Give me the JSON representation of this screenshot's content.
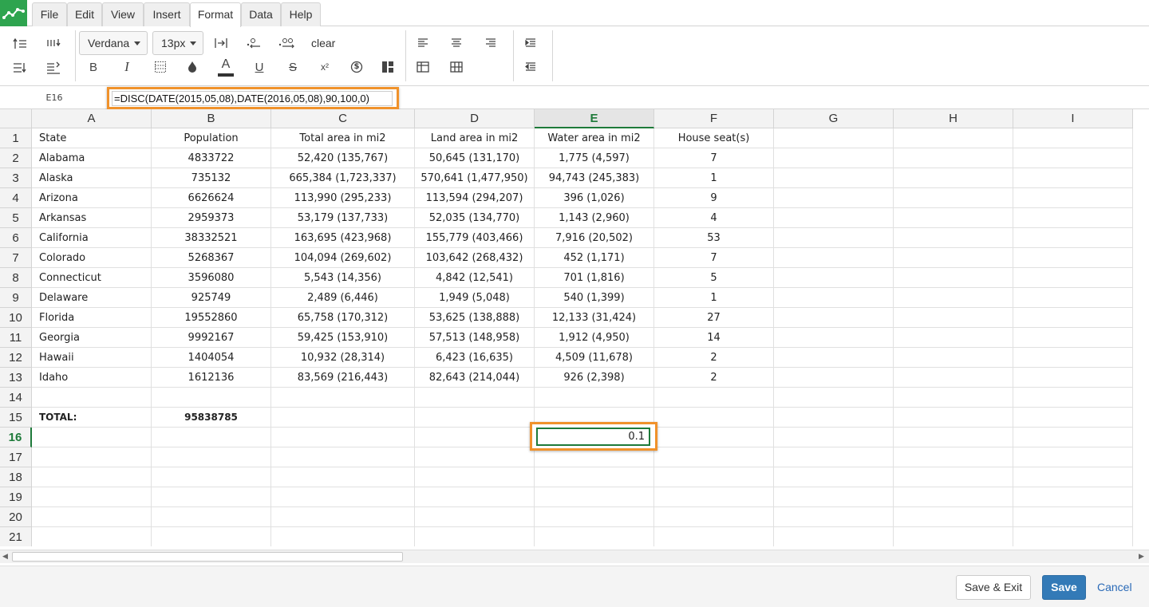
{
  "menu": {
    "tabs": [
      {
        "label": "File",
        "active": false
      },
      {
        "label": "Edit",
        "active": false
      },
      {
        "label": "View",
        "active": false
      },
      {
        "label": "Insert",
        "active": false
      },
      {
        "label": "Format",
        "active": true
      },
      {
        "label": "Data",
        "active": false
      },
      {
        "label": "Help",
        "active": false
      }
    ]
  },
  "toolbar": {
    "font_family": "Verdana",
    "font_size": "13px",
    "clear_label": "clear",
    "bold_label": "B",
    "italic_label": "I",
    "text_color_label": "A",
    "underline_label": "U",
    "strike_label": "S",
    "superscript_label": "x²",
    "currency_label": "$",
    "accent_color": "#333333"
  },
  "formula_bar": {
    "cell_ref": "E16",
    "formula": "=DISC(DATE(2015,05,08),DATE(2016,05,08),90,100,0)"
  },
  "sheet": {
    "columns": [
      "A",
      "B",
      "C",
      "D",
      "E",
      "F",
      "G",
      "H",
      "I"
    ],
    "selected_column": "E",
    "selected_row": "16",
    "row_numbers": [
      "1",
      "2",
      "3",
      "4",
      "5",
      "6",
      "7",
      "8",
      "9",
      "10",
      "11",
      "12",
      "13",
      "14",
      "15",
      "16",
      "17",
      "18",
      "19",
      "20",
      "21"
    ],
    "rows": [
      [
        "State",
        "Population",
        "Total area in mi2",
        "Land area in mi2",
        "Water area in mi2",
        "House seat(s)"
      ],
      [
        "Alabama",
        "4833722",
        "52,420 (135,767)",
        "50,645 (131,170)",
        "1,775 (4,597)",
        "7"
      ],
      [
        "Alaska",
        "735132",
        "665,384 (1,723,337)",
        "570,641 (1,477,950)",
        "94,743 (245,383)",
        "1"
      ],
      [
        "Arizona",
        "6626624",
        "113,990 (295,233)",
        "113,594 (294,207)",
        "396 (1,026)",
        "9"
      ],
      [
        "Arkansas",
        "2959373",
        "53,179 (137,733)",
        "52,035 (134,770)",
        "1,143 (2,960)",
        "4"
      ],
      [
        "California",
        "38332521",
        "163,695 (423,968)",
        "155,779 (403,466)",
        "7,916 (20,502)",
        "53"
      ],
      [
        "Colorado",
        "5268367",
        "104,094 (269,602)",
        "103,642 (268,432)",
        "452 (1,171)",
        "7"
      ],
      [
        "Connecticut",
        "3596080",
        "5,543 (14,356)",
        "4,842 (12,541)",
        "701 (1,816)",
        "5"
      ],
      [
        "Delaware",
        "925749",
        "2,489 (6,446)",
        "1,949 (5,048)",
        "540 (1,399)",
        "1"
      ],
      [
        "Florida",
        "19552860",
        "65,758 (170,312)",
        "53,625 (138,888)",
        "12,133 (31,424)",
        "27"
      ],
      [
        "Georgia",
        "9992167",
        "59,425 (153,910)",
        "57,513 (148,958)",
        "1,912 (4,950)",
        "14"
      ],
      [
        "Hawaii",
        "1404054",
        "10,932 (28,314)",
        "6,423 (16,635)",
        "4,509 (11,678)",
        "2"
      ],
      [
        "Idaho",
        "1612136",
        "83,569 (216,443)",
        "82,643 (214,044)",
        "926 (2,398)",
        "2"
      ]
    ],
    "total_label": "TOTAL:",
    "total_value": "95838785",
    "e16_value": "0.1"
  },
  "footer": {
    "save_exit_label": "Save & Exit",
    "save_label": "Save",
    "cancel_label": "Cancel"
  },
  "colors": {
    "logo_green": "#2ea44f",
    "highlight_orange": "#f0922b",
    "selection_green": "#1e7a3a",
    "save_blue": "#337ab7",
    "cancel_link_blue": "#2a6ab7"
  }
}
